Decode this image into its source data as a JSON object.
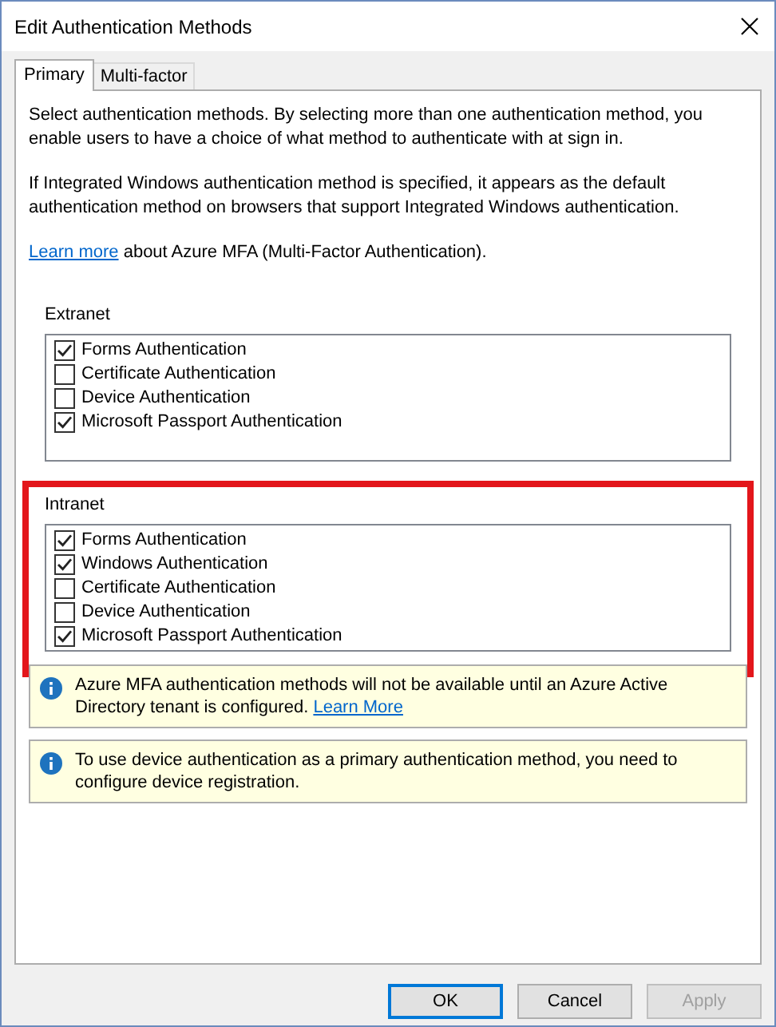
{
  "window": {
    "title": "Edit Authentication Methods"
  },
  "tabs": [
    {
      "label": "Primary",
      "selected": true
    },
    {
      "label": "Multi-factor",
      "selected": false
    }
  ],
  "intro": "Select authentication methods. By selecting more than one authentication method, you enable users to have a choice of what method to authenticate with at sign in.",
  "note": "If Integrated Windows authentication method is specified, it appears as the default authentication method on browsers that support Integrated Windows authentication.",
  "learn_more": {
    "link": "Learn more",
    "text": "about Azure MFA (Multi-Factor Authentication)."
  },
  "groups": [
    {
      "title": "Extranet",
      "highlighted": false,
      "items": [
        {
          "label": "Forms Authentication",
          "checked": true
        },
        {
          "label": "Certificate Authentication",
          "checked": false
        },
        {
          "label": "Device Authentication",
          "checked": false
        },
        {
          "label": "Microsoft Passport Authentication",
          "checked": true
        }
      ]
    },
    {
      "title": "Intranet",
      "highlighted": true,
      "items": [
        {
          "label": "Forms Authentication",
          "checked": true
        },
        {
          "label": "Windows Authentication",
          "checked": true
        },
        {
          "label": "Certificate Authentication",
          "checked": false
        },
        {
          "label": "Device Authentication",
          "checked": false
        },
        {
          "label": "Microsoft Passport Authentication",
          "checked": true
        }
      ]
    }
  ],
  "notices": [
    {
      "text": "Azure MFA authentication methods will not be available until an Azure Active Directory tenant is configured.",
      "link": "Learn More"
    },
    {
      "text": "To use device authentication as a primary authentication method, you need to configure device registration."
    }
  ],
  "buttons": [
    {
      "label": "OK",
      "default": true,
      "disabled": false
    },
    {
      "label": "Cancel",
      "default": false,
      "disabled": false
    },
    {
      "label": "Apply",
      "default": false,
      "disabled": true
    }
  ]
}
